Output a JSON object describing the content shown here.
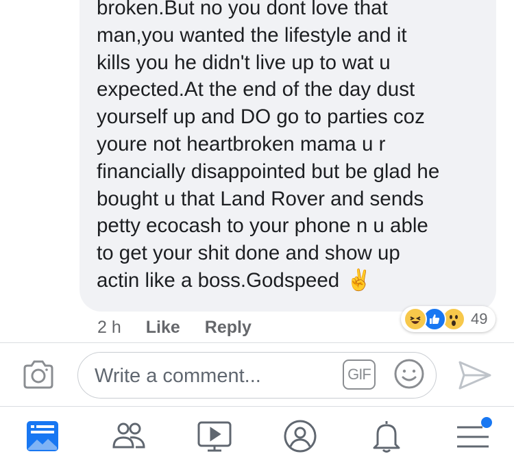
{
  "comment": {
    "text": "broken.But no you dont love that\nman,you wanted the lifestyle and it\nkills you he didn't live up to wat u\nexpected.At the end of the day dust\nyourself up and DO go to parties coz\nyoure not heartbroken mama u r\nfinancially disappointed but be glad he\nbought u that Land Rover and sends\npetty ecocash to your phone n u able\nto get your shit done and show up\nactin like a boss.Godspeed",
    "emoji": "✌️",
    "time": "2 h",
    "like_label": "Like",
    "reply_label": "Reply",
    "reactions": {
      "types": [
        "haha-icon",
        "like-icon",
        "wow-icon"
      ],
      "count": "49"
    }
  },
  "composer": {
    "placeholder": "Write a comment...",
    "gif_label": "GIF",
    "icons": [
      "camera-icon",
      "gif-icon",
      "smiley-icon",
      "send-icon"
    ]
  },
  "tabbar": {
    "tabs": [
      "news-feed-icon",
      "friends-icon",
      "watch-icon",
      "profile-icon",
      "notifications-icon",
      "menu-icon"
    ],
    "active": "news-feed-icon",
    "active_color": "#1877f2",
    "inactive_color": "#606770"
  }
}
